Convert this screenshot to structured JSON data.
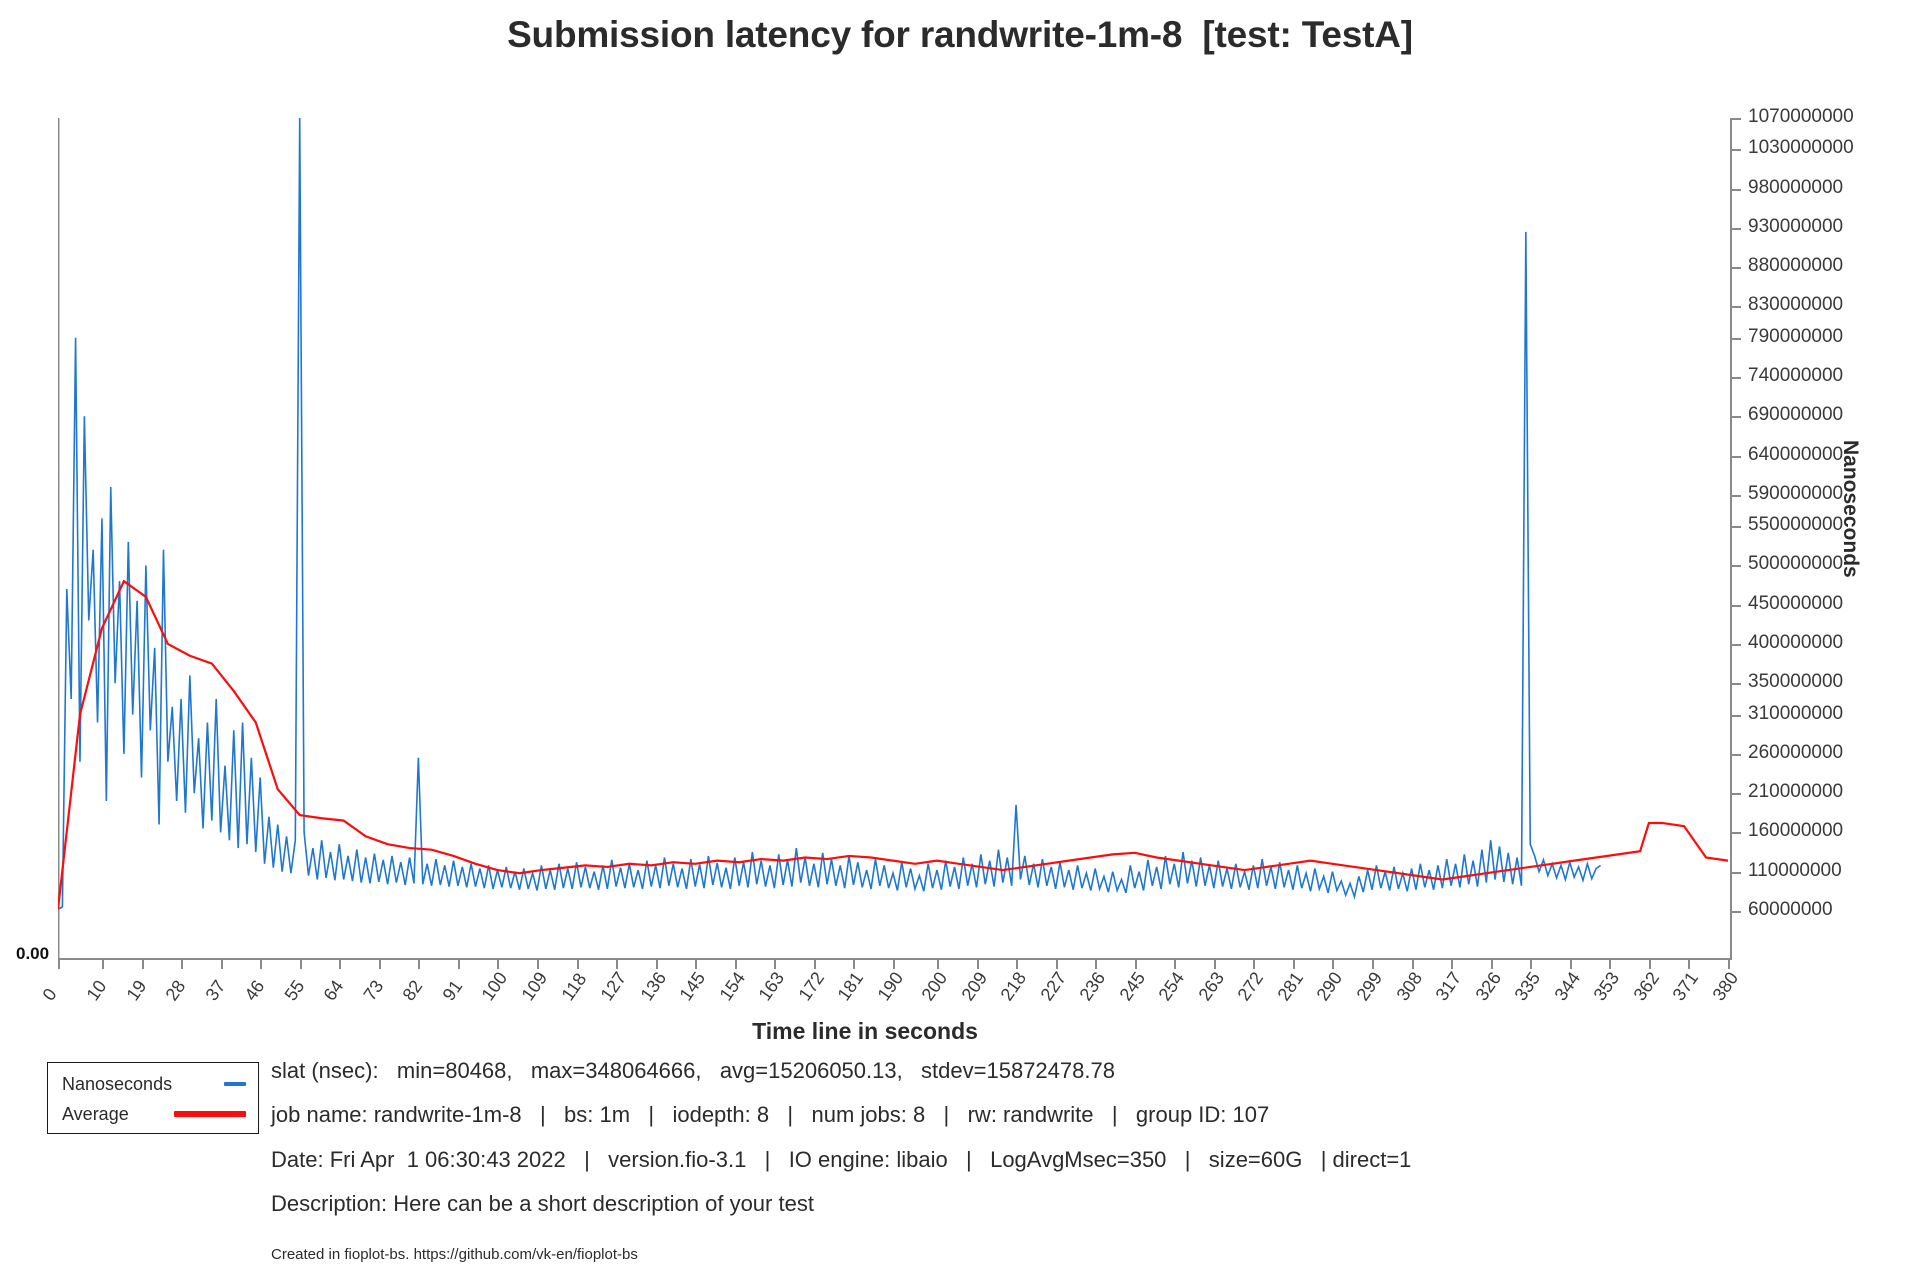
{
  "title": "Submission latency for randwrite-1m-8  [test: TestA]",
  "axes": {
    "x_title": "Time line in seconds",
    "y_title": "Nanoseconds",
    "zero_label": "0.00"
  },
  "legend": {
    "series_label": "Nanoseconds",
    "average_label": "Average",
    "series_color": "#1f77d0",
    "average_color": "#fb0d0d"
  },
  "info": {
    "stats_line": "slat (nsec):   min=80468,   max=348064666,   avg=15206050.13,   stdev=15872478.78",
    "job_line": "job name: randwrite-1m-8   |   bs: 1m   |   iodepth: 8   |   num jobs: 8   |   rw: randwrite   |   group ID: 107",
    "date_line": "Date: Fri Apr  1 06:30:43 2022   |   version.fio-3.1   |   IO engine: libaio   |   LogAvgMsec=350   |   size=60G   | direct=1",
    "description_line": "Description: Here can be a short description of your test",
    "footer_line": "Created in fioplot-bs. https://github.com/vk-en/fioplot-bs"
  },
  "chart_data": {
    "type": "line",
    "title": "Submission latency for randwrite-1m-8  [test: TestA]",
    "xlabel": "Time line in seconds",
    "ylabel": "Nanoseconds",
    "xlim": [
      0,
      380
    ],
    "ylim": [
      0,
      1070000000
    ],
    "grid": false,
    "legend_position": "below-left",
    "x_ticks": [
      0,
      10,
      19,
      28,
      37,
      46,
      55,
      64,
      73,
      82,
      91,
      100,
      109,
      118,
      127,
      136,
      145,
      154,
      163,
      172,
      181,
      190,
      200,
      209,
      218,
      227,
      236,
      245,
      254,
      263,
      272,
      281,
      290,
      299,
      308,
      317,
      326,
      335,
      344,
      353,
      362,
      371,
      380
    ],
    "y_ticks": [
      60000000,
      110000000,
      160000000,
      210000000,
      260000000,
      310000000,
      350000000,
      400000000,
      450000000,
      500000000,
      550000000,
      590000000,
      640000000,
      690000000,
      740000000,
      790000000,
      830000000,
      880000000,
      930000000,
      980000000,
      1030000000,
      1070000000
    ],
    "series": [
      {
        "name": "Nanoseconds",
        "color": "#1f77d0",
        "x": [
          0,
          1,
          2,
          3,
          4,
          5,
          6,
          7,
          8,
          9,
          10,
          11,
          12,
          13,
          14,
          15,
          16,
          17,
          18,
          19,
          20,
          21,
          22,
          23,
          24,
          25,
          26,
          27,
          28,
          29,
          30,
          31,
          32,
          33,
          34,
          35,
          36,
          37,
          38,
          39,
          40,
          41,
          42,
          43,
          44,
          45,
          46,
          47,
          48,
          49,
          50,
          51,
          52,
          53,
          54,
          55,
          56,
          57,
          58,
          59,
          60,
          61,
          62,
          63,
          64,
          65,
          66,
          67,
          68,
          69,
          70,
          71,
          72,
          73,
          74,
          75,
          76,
          77,
          78,
          79,
          80,
          81,
          82,
          83,
          84,
          85,
          86,
          87,
          88,
          89,
          90,
          91,
          92,
          93,
          94,
          95,
          96,
          97,
          98,
          99,
          100,
          101,
          102,
          103,
          104,
          105,
          106,
          107,
          108,
          109,
          110,
          111,
          112,
          113,
          114,
          115,
          116,
          117,
          118,
          119,
          120,
          121,
          122,
          123,
          124,
          125,
          126,
          127,
          128,
          129,
          130,
          131,
          132,
          133,
          134,
          135,
          136,
          137,
          138,
          139,
          140,
          141,
          142,
          143,
          144,
          145,
          146,
          147,
          148,
          149,
          150,
          151,
          152,
          153,
          154,
          155,
          156,
          157,
          158,
          159,
          160,
          161,
          162,
          163,
          164,
          165,
          166,
          167,
          168,
          169,
          170,
          171,
          172,
          173,
          174,
          175,
          176,
          177,
          178,
          179,
          180,
          181,
          182,
          183,
          184,
          185,
          186,
          187,
          188,
          189,
          190,
          191,
          192,
          193,
          194,
          195,
          196,
          197,
          198,
          199,
          200,
          201,
          202,
          203,
          204,
          205,
          206,
          207,
          208,
          209,
          210,
          211,
          212,
          213,
          214,
          215,
          216,
          217,
          218,
          219,
          220,
          221,
          222,
          223,
          224,
          225,
          226,
          227,
          228,
          229,
          230,
          231,
          232,
          233,
          234,
          235,
          236,
          237,
          238,
          239,
          240,
          241,
          242,
          243,
          244,
          245,
          246,
          247,
          248,
          249,
          250,
          251,
          252,
          253,
          254,
          255,
          256,
          257,
          258,
          259,
          260,
          261,
          262,
          263,
          264,
          265,
          266,
          267,
          268,
          269,
          270,
          271,
          272,
          273,
          274,
          275,
          276,
          277,
          278,
          279,
          280,
          281,
          282,
          283,
          284,
          285,
          286,
          287,
          288,
          289,
          290,
          291,
          292,
          293,
          294,
          295,
          296,
          297,
          298,
          299,
          300,
          301,
          302,
          303,
          304,
          305,
          306,
          307,
          308,
          309,
          310,
          311,
          312,
          313,
          314,
          315,
          316,
          317,
          318,
          319,
          320,
          321,
          322,
          323,
          324,
          325,
          326,
          327,
          328,
          329,
          330,
          331,
          332,
          333,
          334,
          335,
          336,
          337,
          338,
          339,
          340,
          341,
          342,
          343,
          344,
          345,
          346,
          347,
          348,
          349,
          350,
          351,
          352,
          353,
          354,
          355,
          356,
          357,
          358,
          359,
          360,
          361,
          362,
          363,
          364,
          365,
          366,
          367,
          368,
          369,
          370,
          371,
          372,
          373,
          374,
          375,
          376,
          377,
          378,
          379,
          380
        ],
        "y": [
          62000000,
          65000000,
          470000000,
          330000000,
          790000000,
          250000000,
          690000000,
          430000000,
          520000000,
          300000000,
          560000000,
          200000000,
          600000000,
          350000000,
          480000000,
          260000000,
          530000000,
          310000000,
          455000000,
          230000000,
          500000000,
          290000000,
          395000000,
          170000000,
          520000000,
          250000000,
          320000000,
          200000000,
          330000000,
          185000000,
          360000000,
          210000000,
          280000000,
          165000000,
          300000000,
          175000000,
          330000000,
          160000000,
          245000000,
          150000000,
          290000000,
          140000000,
          300000000,
          145000000,
          255000000,
          135000000,
          230000000,
          120000000,
          180000000,
          115000000,
          170000000,
          110000000,
          155000000,
          108000000,
          150000000,
          1070000000,
          160000000,
          105000000,
          140000000,
          100000000,
          150000000,
          102000000,
          135000000,
          99000000,
          145000000,
          100000000,
          130000000,
          98000000,
          138000000,
          96000000,
          128000000,
          95000000,
          133000000,
          97000000,
          125000000,
          94000000,
          130000000,
          96000000,
          122000000,
          93000000,
          128000000,
          95000000,
          255000000,
          94000000,
          120000000,
          92000000,
          126000000,
          93000000,
          118000000,
          91000000,
          124000000,
          92000000,
          116000000,
          90000000,
          120000000,
          91000000,
          114000000,
          89000000,
          118000000,
          88000000,
          112000000,
          90000000,
          116000000,
          89000000,
          110000000,
          87000000,
          114000000,
          88000000,
          108000000,
          86000000,
          118000000,
          88000000,
          112000000,
          87000000,
          120000000,
          89000000,
          114000000,
          88000000,
          122000000,
          90000000,
          116000000,
          89000000,
          110000000,
          87000000,
          118000000,
          88000000,
          125000000,
          91000000,
          115000000,
          89000000,
          120000000,
          90000000,
          112000000,
          88000000,
          124000000,
          91000000,
          118000000,
          89000000,
          128000000,
          92000000,
          120000000,
          90000000,
          114000000,
          88000000,
          126000000,
          91000000,
          119000000,
          89000000,
          130000000,
          93000000,
          121000000,
          90000000,
          115000000,
          88000000,
          128000000,
          92000000,
          122000000,
          90000000,
          135000000,
          94000000,
          124000000,
          91000000,
          118000000,
          89000000,
          132000000,
          93000000,
          125000000,
          91000000,
          140000000,
          96000000,
          128000000,
          92000000,
          120000000,
          90000000,
          134000000,
          94000000,
          126000000,
          92000000,
          118000000,
          89000000,
          130000000,
          93000000,
          122000000,
          90000000,
          112000000,
          88000000,
          126000000,
          92000000,
          118000000,
          89000000,
          108000000,
          86000000,
          122000000,
          90000000,
          114000000,
          88000000,
          105000000,
          85000000,
          120000000,
          89000000,
          112000000,
          87000000,
          124000000,
          91000000,
          116000000,
          88000000,
          128000000,
          92000000,
          120000000,
          90000000,
          132000000,
          94000000,
          124000000,
          91000000,
          138000000,
          96000000,
          128000000,
          92000000,
          195000000,
          100000000,
          130000000,
          93000000,
          120000000,
          90000000,
          126000000,
          92000000,
          116000000,
          88000000,
          122000000,
          90000000,
          112000000,
          87000000,
          118000000,
          89000000,
          108000000,
          86000000,
          114000000,
          88000000,
          104000000,
          84000000,
          110000000,
          86000000,
          100000000,
          83000000,
          118000000,
          89000000,
          110000000,
          86000000,
          125000000,
          92000000,
          116000000,
          88000000,
          130000000,
          94000000,
          120000000,
          90000000,
          135000000,
          95000000,
          124000000,
          91000000,
          128000000,
          92000000,
          118000000,
          89000000,
          124000000,
          91000000,
          114000000,
          88000000,
          120000000,
          90000000,
          110000000,
          87000000,
          118000000,
          89000000,
          126000000,
          92000000,
          116000000,
          88000000,
          122000000,
          90000000,
          112000000,
          87000000,
          118000000,
          89000000,
          108000000,
          85000000,
          114000000,
          88000000,
          104000000,
          83000000,
          110000000,
          86000000,
          98000000,
          80000000,
          95000000,
          78000000,
          104000000,
          84000000,
          112000000,
          87000000,
          118000000,
          89000000,
          110000000,
          86000000,
          116000000,
          88000000,
          108000000,
          85000000,
          114000000,
          87000000,
          120000000,
          90000000,
          112000000,
          87000000,
          118000000,
          89000000,
          126000000,
          92000000,
          120000000,
          90000000,
          132000000,
          94000000,
          124000000,
          91000000,
          138000000,
          96000000,
          150000000,
          100000000,
          142000000,
          97000000,
          134000000,
          94000000,
          128000000,
          92000000,
          925000000,
          145000000,
          130000000,
          110000000,
          125000000,
          105000000,
          120000000,
          102000000,
          118000000,
          100000000,
          122000000,
          103000000,
          116000000,
          99000000,
          120000000,
          101000000,
          114000000,
          118000000
        ]
      },
      {
        "name": "Average",
        "color": "#fb0d0d",
        "x": [
          0,
          5,
          10,
          15,
          20,
          25,
          30,
          35,
          40,
          45,
          50,
          55,
          60,
          65,
          70,
          75,
          80,
          85,
          90,
          95,
          100,
          105,
          110,
          115,
          120,
          125,
          130,
          135,
          140,
          145,
          150,
          155,
          160,
          165,
          170,
          175,
          180,
          185,
          190,
          195,
          200,
          205,
          210,
          215,
          220,
          225,
          230,
          235,
          240,
          245,
          250,
          255,
          260,
          265,
          270,
          275,
          280,
          285,
          290,
          295,
          300,
          305,
          310,
          315,
          320,
          325,
          330,
          335,
          340,
          345,
          350,
          355,
          360,
          362,
          365,
          370,
          375,
          380
        ],
        "y": [
          62000000,
          310000000,
          420000000,
          480000000,
          460000000,
          400000000,
          385000000,
          375000000,
          340000000,
          300000000,
          215000000,
          182000000,
          178000000,
          175000000,
          155000000,
          145000000,
          140000000,
          138000000,
          130000000,
          120000000,
          112000000,
          108000000,
          112000000,
          115000000,
          118000000,
          116000000,
          120000000,
          118000000,
          122000000,
          120000000,
          124000000,
          122000000,
          126000000,
          124000000,
          128000000,
          126000000,
          130000000,
          128000000,
          124000000,
          120000000,
          124000000,
          120000000,
          116000000,
          112000000,
          116000000,
          120000000,
          124000000,
          128000000,
          132000000,
          134000000,
          128000000,
          124000000,
          120000000,
          116000000,
          112000000,
          116000000,
          120000000,
          124000000,
          120000000,
          116000000,
          112000000,
          108000000,
          104000000,
          100000000,
          104000000,
          108000000,
          112000000,
          116000000,
          120000000,
          124000000,
          128000000,
          132000000,
          136000000,
          172000000,
          172000000,
          168000000,
          128000000,
          124000000
        ]
      }
    ]
  }
}
